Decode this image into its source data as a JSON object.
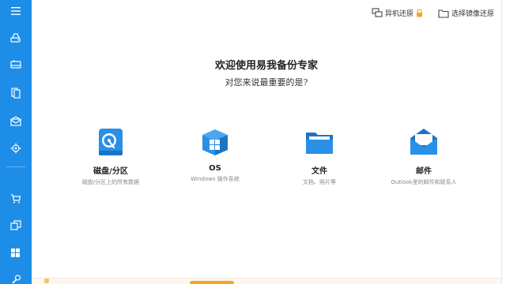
{
  "sidebar": {
    "items": [
      {
        "icon": "hamburger-menu-icon"
      },
      {
        "icon": "disk-backup-icon"
      },
      {
        "icon": "system-backup-icon"
      },
      {
        "icon": "file-backup-icon"
      },
      {
        "icon": "mail-backup-icon"
      },
      {
        "icon": "smart-backup-icon"
      },
      {
        "icon": "cart-icon"
      },
      {
        "icon": "clone-icon"
      },
      {
        "icon": "windows-tools-icon"
      },
      {
        "icon": "tools-icon"
      }
    ]
  },
  "topbar": {
    "restore_other_label": "异机还原",
    "restore_image_label": "选择镜像还原"
  },
  "main": {
    "title": "欢迎使用易我备份专家",
    "subtitle": "对您来说最重要的是?"
  },
  "tiles": [
    {
      "icon": "disk-icon",
      "label": "磁盘/分区",
      "desc": "磁盘/分区上的所有数据"
    },
    {
      "icon": "os-icon",
      "label": "OS",
      "desc": "Windows 操作系统"
    },
    {
      "icon": "folder-icon",
      "label": "文件",
      "desc": "文档、照片等"
    },
    {
      "icon": "mail-icon",
      "label": "邮件",
      "desc": "Outlook里的邮件和联系人"
    }
  ],
  "colors": {
    "sidebar": "#1d8de8",
    "icon_blue": "#2a8fe6",
    "lock": "#f5a623"
  }
}
